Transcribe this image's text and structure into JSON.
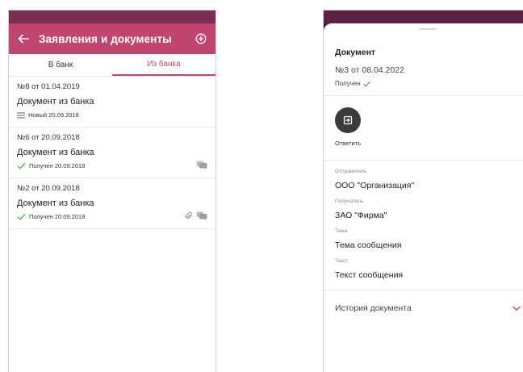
{
  "left": {
    "appbar_title": "Заявления и документы",
    "tabs": [
      {
        "label": "В банк"
      },
      {
        "label": "Из банка"
      }
    ],
    "documents": [
      {
        "number": "№8 от 01.04.2019",
        "title": "Документ из банка",
        "status": "Новый 20.09.2018"
      },
      {
        "number": "№6 от 20.09.2018",
        "title": "Документ из банка",
        "status": "Получен 20.09.2018"
      },
      {
        "number": "№2 от 20.09.2018",
        "title": "Документ из банка",
        "status": "Получен 20.09.2018"
      }
    ]
  },
  "right": {
    "heading": "Документ",
    "subtitle": "№3 от 08.04.2022",
    "status": "Получен",
    "reply_label": "Ответить",
    "fields": [
      {
        "label": "Отправитель",
        "value": "ООО \"Организация\""
      },
      {
        "label": "Получатель",
        "value": "ЗАО \"Фирма\""
      },
      {
        "label": "Тема",
        "value": "Тема сообщения"
      },
      {
        "label": "Текст",
        "value": "Текст сообщения"
      }
    ],
    "history_label": "История документа"
  },
  "colors": {
    "accent": "#c0456f",
    "status_bar": "#7a2e54",
    "check": "#4caf50"
  }
}
